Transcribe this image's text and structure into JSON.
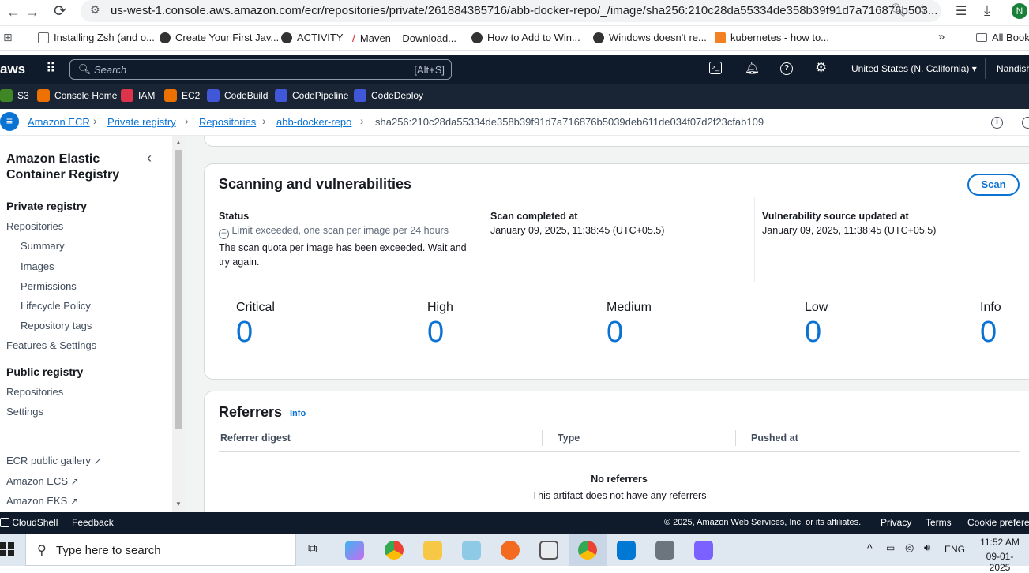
{
  "browser": {
    "url": "us-west-1.console.aws.amazon.com/ecr/repositories/private/261884385716/abb-docker-repo/_/image/sha256:210c28da55334de358b39f91d7a716876b503...",
    "profile_initial": "N",
    "bookmarks": [
      "Installing Zsh (and o...",
      "Create Your First Jav...",
      "ACTIVITY",
      "Maven – Download...",
      "How to Add to Win...",
      "Windows doesn't re...",
      "kubernetes - how to...",
      "All Book"
    ]
  },
  "aws_nav": {
    "logo": "aws",
    "search_placeholder": "Search",
    "search_shortcut": "[Alt+S]",
    "region": "United States (N. California)",
    "user": "Nandish",
    "favorites": [
      "S3",
      "Console Home",
      "IAM",
      "EC2",
      "CodeBuild",
      "CodePipeline",
      "CodeDeploy"
    ]
  },
  "breadcrumb": {
    "items": [
      "Amazon ECR",
      "Private registry",
      "Repositories",
      "abb-docker-repo"
    ],
    "current": "sha256:210c28da55334de358b39f91d7a716876b5039deb611de034f07d2f23cfab109"
  },
  "sidebar": {
    "title": "Amazon Elastic Container Registry",
    "private_header": "Private registry",
    "private_items": [
      "Repositories",
      "Summary",
      "Images",
      "Permissions",
      "Lifecycle Policy",
      "Repository tags",
      "Features & Settings"
    ],
    "public_header": "Public registry",
    "public_items": [
      "Repositories",
      "Settings"
    ],
    "external_links": [
      "ECR public gallery",
      "Amazon ECS",
      "Amazon EKS"
    ]
  },
  "scanning": {
    "title": "Scanning and vulnerabilities",
    "scan_button": "Scan",
    "status_label": "Status",
    "status_value": "Limit exceeded, one scan per image per 24 hours",
    "status_note": "The scan quota per image has been exceeded. Wait and try again.",
    "completed_label": "Scan completed at",
    "completed_value": "January 09, 2025, 11:38:45 (UTC+05.5)",
    "vuln_label": "Vulnerability source updated at",
    "vuln_value": "January 09, 2025, 11:38:45 (UTC+05.5)",
    "severities": [
      {
        "label": "Critical",
        "count": "0"
      },
      {
        "label": "High",
        "count": "0"
      },
      {
        "label": "Medium",
        "count": "0"
      },
      {
        "label": "Low",
        "count": "0"
      },
      {
        "label": "Info",
        "count": "0"
      }
    ]
  },
  "referrers": {
    "title": "Referrers",
    "info": "Info",
    "columns": [
      "Referrer digest",
      "Type",
      "Pushed at"
    ],
    "empty_title": "No referrers",
    "empty_text": "This artifact does not have any referrers"
  },
  "footer": {
    "cloudshell": "CloudShell",
    "feedback": "Feedback",
    "copyright": "© 2025, Amazon Web Services, Inc. or its affiliates.",
    "privacy": "Privacy",
    "terms": "Terms",
    "cookie": "Cookie preferen"
  },
  "taskbar": {
    "search_placeholder": "Type here to search",
    "lang": "ENG",
    "time": "11:52 AM",
    "date": "09-01-2025"
  },
  "colors": {
    "aws_nav": "#0f1b2a",
    "link": "#0972d3",
    "accent_orange": "#ff9900"
  }
}
